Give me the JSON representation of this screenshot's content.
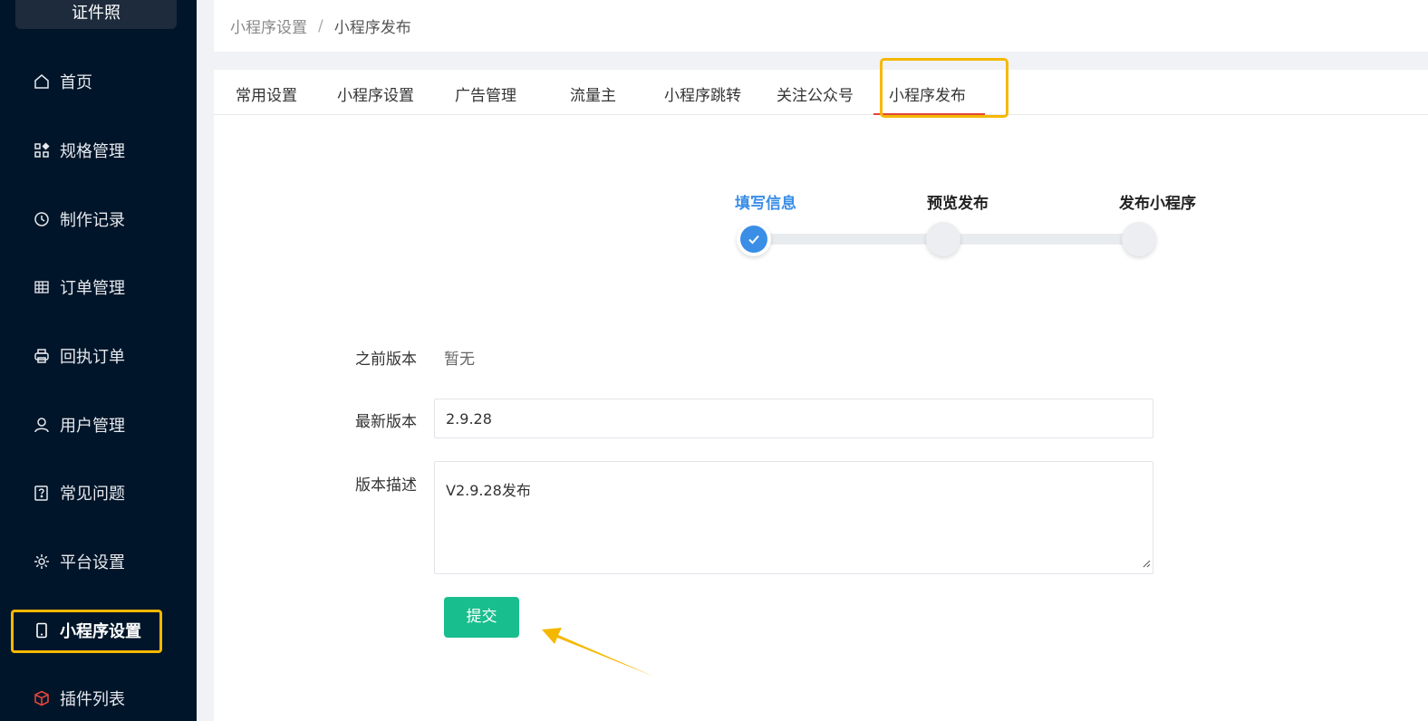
{
  "sidebar": {
    "logo": "证件照",
    "items": [
      {
        "label": "首页",
        "icon": "home-icon"
      },
      {
        "label": "规格管理",
        "icon": "grid-icon"
      },
      {
        "label": "制作记录",
        "icon": "clock-icon"
      },
      {
        "label": "订单管理",
        "icon": "table-icon"
      },
      {
        "label": "回执订单",
        "icon": "printer-icon"
      },
      {
        "label": "用户管理",
        "icon": "user-icon"
      },
      {
        "label": "常见问题",
        "icon": "question-icon"
      },
      {
        "label": "平台设置",
        "icon": "gear-icon"
      },
      {
        "label": "小程序设置",
        "icon": "phone-icon"
      },
      {
        "label": "插件列表",
        "icon": "cube-icon"
      }
    ],
    "active_index": 8
  },
  "breadcrumb": {
    "parent": "小程序设置",
    "separator": "/",
    "current": "小程序发布"
  },
  "tabs": {
    "items": [
      "常用设置",
      "小程序设置",
      "广告管理",
      "流量主",
      "小程序跳转",
      "关注公众号",
      "小程序发布"
    ],
    "active_index": 6
  },
  "steps": {
    "items": [
      {
        "title": "填写信息",
        "status": "done"
      },
      {
        "title": "预览发布",
        "status": "wait"
      },
      {
        "title": "发布小程序",
        "status": "wait"
      }
    ]
  },
  "form": {
    "prev_version_label": "之前版本",
    "prev_version_value": "暂无",
    "latest_version_label": "最新版本",
    "latest_version_value": "2.9.28",
    "description_label": "版本描述",
    "description_value": "V2.9.28发布",
    "submit_label": "提交"
  },
  "colors": {
    "sidebar_bg": "#001529",
    "highlight": "#f5b800",
    "step_active": "#3a8ee6",
    "submit": "#19be8e",
    "tab_underline": "#e2463b"
  }
}
